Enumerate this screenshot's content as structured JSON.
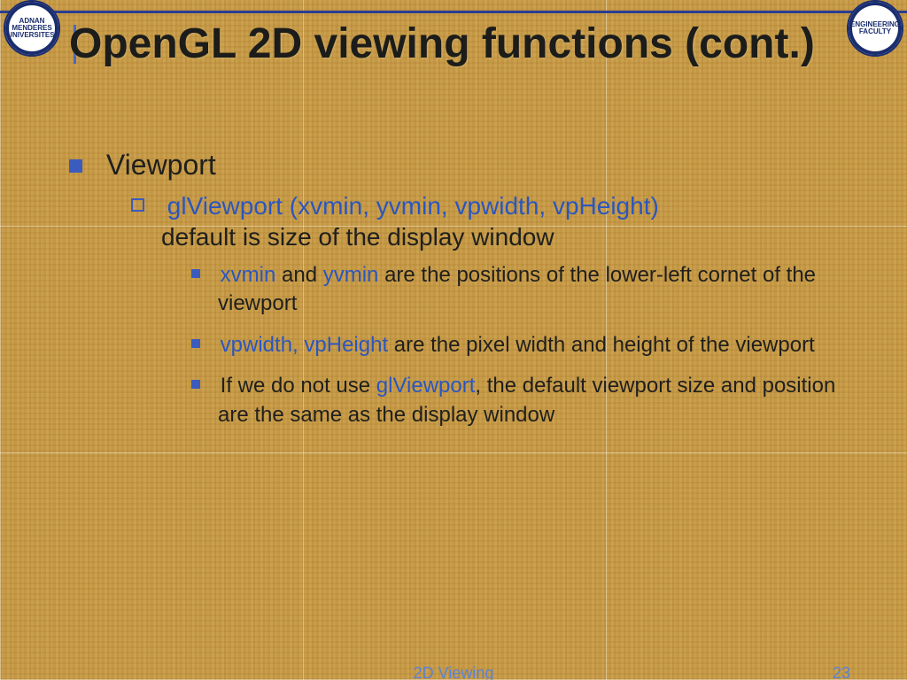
{
  "title": "OpenGL 2D viewing functions (cont.)",
  "bullets": {
    "l1": "Viewport",
    "l2": {
      "code": "glViewport (xvmin, yvmin, vpwidth, vpHeight)",
      "rest": "default is size of the display window"
    },
    "l3a": {
      "k1": "xvmin",
      "t1": " and ",
      "k2": "yvmin",
      "t2": " are the positions of the lower-left cornet of the viewport"
    },
    "l3b": {
      "k1": "vpwidth, vpHeight",
      "t1": " are the pixel width and height of the viewport"
    },
    "l3c": {
      "t1": "If we do not use ",
      "k1": "glViewport",
      "t2": ", the default viewport size and position are the same as the display window"
    }
  },
  "footer": {
    "center": "2D Viewing",
    "page": "23"
  },
  "logos": {
    "left": "ADNAN MENDERES UNIVERSITESI",
    "right": "ENGINEERING FACULTY"
  }
}
